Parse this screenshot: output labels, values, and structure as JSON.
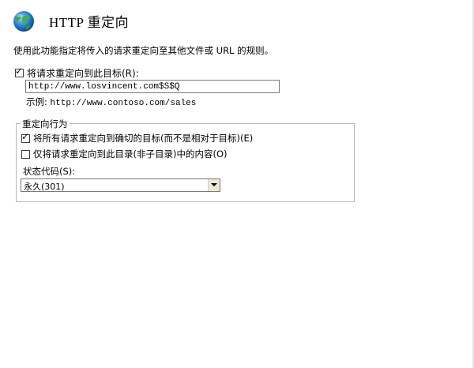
{
  "header": {
    "title": "HTTP 重定向",
    "icon": "globe-icon"
  },
  "description": "使用此功能指定将传入的请求重定向至其他文件或 URL 的规则。",
  "redirect_to": {
    "checked": true,
    "label": "将请求重定向到此目标(R):",
    "value": "http://www.losvincent.com$S$Q",
    "example_prefix": "示例:",
    "example_url": "http://www.contoso.com/sales"
  },
  "behavior": {
    "title": "重定向行为",
    "exact_destination": {
      "checked": true,
      "label": "将所有请求重定向到确切的目标(而不是相对于目标)(E)"
    },
    "only_this_directory": {
      "checked": false,
      "label": "仅将请求重定向到此目录(非子目录)中的内容(O)"
    },
    "status_code_label": "状态代码(S):",
    "status_code_value": "永久(301)"
  },
  "colors": {
    "group_border": "#b8b8b8",
    "input_border": "#7a7a7a",
    "dropdown_button": "#ece9d8"
  }
}
